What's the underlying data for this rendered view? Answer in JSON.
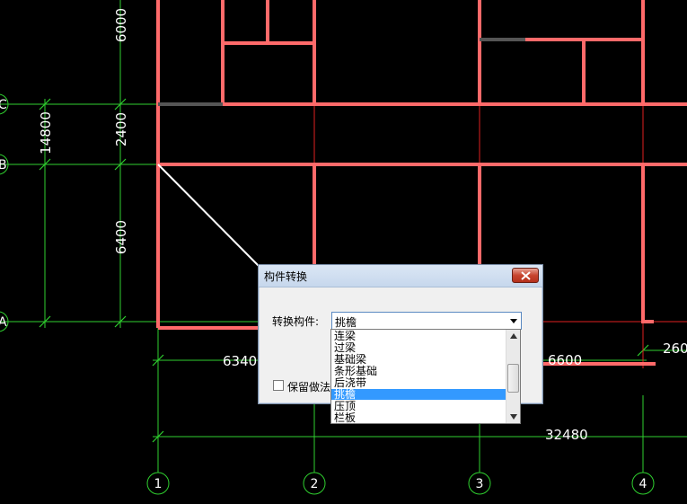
{
  "drawing": {
    "dimensions": {
      "d6000": "6000",
      "d2400": "2400",
      "d14800": "14800",
      "d6400": "6400",
      "d6340": "6340",
      "d6600": "6600",
      "d260": "260",
      "d32480": "32480"
    },
    "axes": {
      "row_c": "C",
      "row_b": "B",
      "row_a": "A",
      "col_1": "1",
      "col_2": "2",
      "col_3": "3",
      "col_4": "4"
    },
    "colors": {
      "wall": "#ff6a6a",
      "grid": "#2fcf2f",
      "thin_line": "#e02020",
      "background": "#000000"
    }
  },
  "dialog": {
    "title": "构件转换",
    "field_label": "转换构件:",
    "selected_value": "挑檐",
    "checkbox_label": "保留做法",
    "checkbox_checked": false,
    "options": [
      "连梁",
      "过梁",
      "基础梁",
      "条形基础",
      "后浇带",
      "挑檐",
      "压顶",
      "栏板"
    ],
    "highlighted_index": 5
  }
}
